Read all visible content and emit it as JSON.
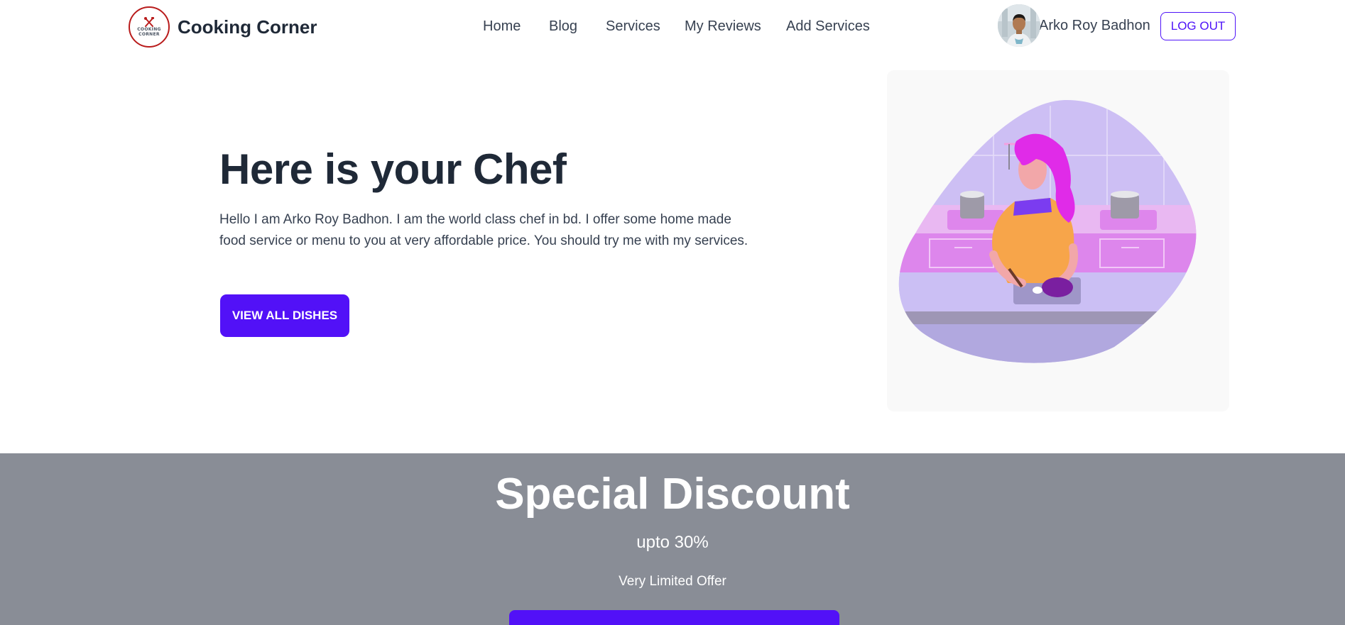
{
  "brand": {
    "name": "Cooking Corner",
    "logo_text_line1": "COOKING",
    "logo_text_line2": "CORNER",
    "logo_icon": "crossed-utensils-icon"
  },
  "nav": {
    "items": [
      {
        "label": "Home"
      },
      {
        "label": "Blog"
      },
      {
        "label": "Services"
      },
      {
        "label": "My Reviews"
      },
      {
        "label": "Add Services"
      }
    ]
  },
  "user": {
    "name": "Arko Roy Badhon",
    "logout_label": "LOG OUT"
  },
  "hero": {
    "title": "Here is your Chef",
    "description": "Hello I am Arko Roy Badhon. I am the world class chef in bd. I offer some home made food service or menu to you at very affordable price. You should try me with my services.",
    "button_label": "VIEW ALL DISHES",
    "illustration": "chef-cooking-illustration"
  },
  "discount": {
    "title": "Special Discount",
    "subtitle": "upto 30%",
    "note": "Very Limited Offer"
  },
  "colors": {
    "accent": "#5211f7",
    "banner": "#898d96",
    "text": "#1f2937",
    "logo_ring": "#b91c1c"
  }
}
